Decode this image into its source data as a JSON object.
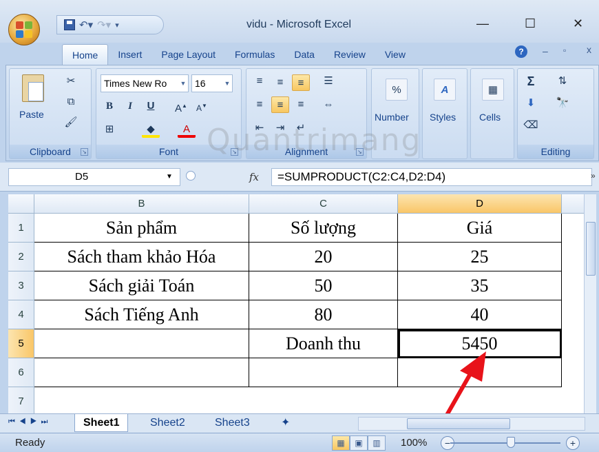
{
  "app": {
    "title": "vidu - Microsoft Excel",
    "window_controls": [
      "—",
      "☐",
      "✕"
    ]
  },
  "ribbon": {
    "tabs": [
      "Home",
      "Insert",
      "Page Layout",
      "Formulas",
      "Data",
      "Review",
      "View"
    ],
    "active_tab": "Home",
    "clipboard": {
      "paste": "Paste",
      "label": "Clipboard"
    },
    "font": {
      "name": "Times New Ro",
      "size": "16",
      "label": "Font",
      "bold": "B",
      "italic": "I",
      "underline": "U"
    },
    "alignment": {
      "label": "Alignment"
    },
    "number": {
      "label": "Number"
    },
    "styles": {
      "label": "Styles"
    },
    "cells": {
      "label": "Cells"
    },
    "editing": {
      "label": "Editing",
      "sum": "Σ"
    }
  },
  "formula_bar": {
    "name_box": "D5",
    "fx": "fx",
    "formula": "=SUMPRODUCT(C2:C4,D2:D4)"
  },
  "sheet": {
    "columns": [
      "B",
      "C",
      "D"
    ],
    "selected_column": "D",
    "rows": [
      "1",
      "2",
      "3",
      "4",
      "5",
      "6",
      "7"
    ],
    "selected_row": "5",
    "cells": [
      [
        "Sản phẩm",
        "Số lượng",
        "Giá"
      ],
      [
        "Sách tham khảo Hóa",
        "20",
        "25"
      ],
      [
        "Sách giải Toán",
        "50",
        "35"
      ],
      [
        "Sách Tiếng Anh",
        "80",
        "40"
      ],
      [
        "",
        "Doanh thu",
        "5450"
      ],
      [
        "",
        "",
        ""
      ]
    ]
  },
  "sheet_tabs": [
    "Sheet1",
    "Sheet2",
    "Sheet3"
  ],
  "active_sheet": "Sheet1",
  "status": {
    "ready": "Ready",
    "zoom": "100%"
  },
  "watermark": "Quantrimang",
  "colors": {
    "accent": "#f9c668",
    "ribbon_bg": "#c5d8ef",
    "arrow": "#e8131a"
  }
}
